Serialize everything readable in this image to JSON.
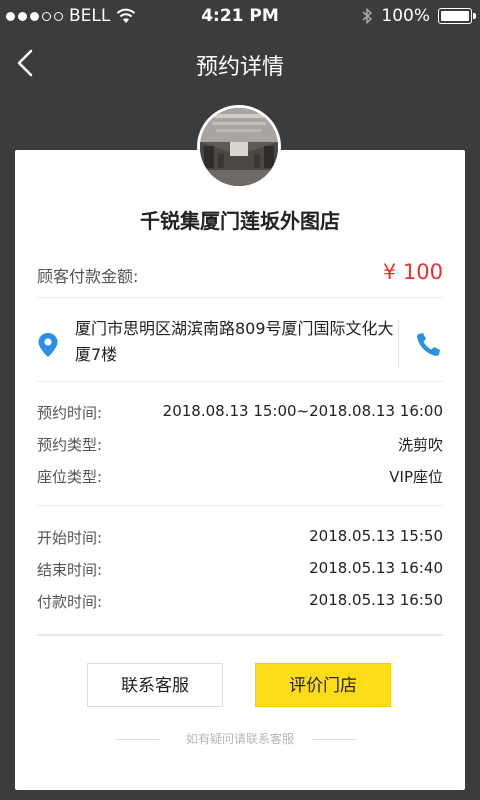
{
  "status_bar": {
    "carrier": "BELL",
    "time": "4:21 PM",
    "battery": "100%"
  },
  "nav": {
    "title": "预约详情"
  },
  "store": {
    "name": "千锐集厦门莲坂外图店"
  },
  "payment": {
    "label": "顾客付款金额:",
    "value": "¥ 100"
  },
  "address": {
    "text": "厦门市思明区湖滨南路809号厦门国际文化大厦7楼"
  },
  "booking": [
    {
      "label": "预约时间:",
      "value": "2018.08.13 15:00~2018.08.13 16:00"
    },
    {
      "label": "预约类型:",
      "value": "洗剪吹"
    },
    {
      "label": "座位类型:",
      "value": "VIP座位"
    }
  ],
  "times": [
    {
      "label": "开始时间:",
      "value": "2018.05.13  15:50"
    },
    {
      "label": "结束时间:",
      "value": "2018.05.13  16:40"
    },
    {
      "label": "付款时间:",
      "value": "2018.05.13  16:50"
    }
  ],
  "buttons": {
    "contact": "联系客服",
    "review": "评价门店"
  },
  "help_text": "如有疑问请联系客服",
  "colors": {
    "background": "#3b3c3e",
    "accent": "#fddc18",
    "price": "#e8322b",
    "icon_blue": "#2b8fe3"
  }
}
